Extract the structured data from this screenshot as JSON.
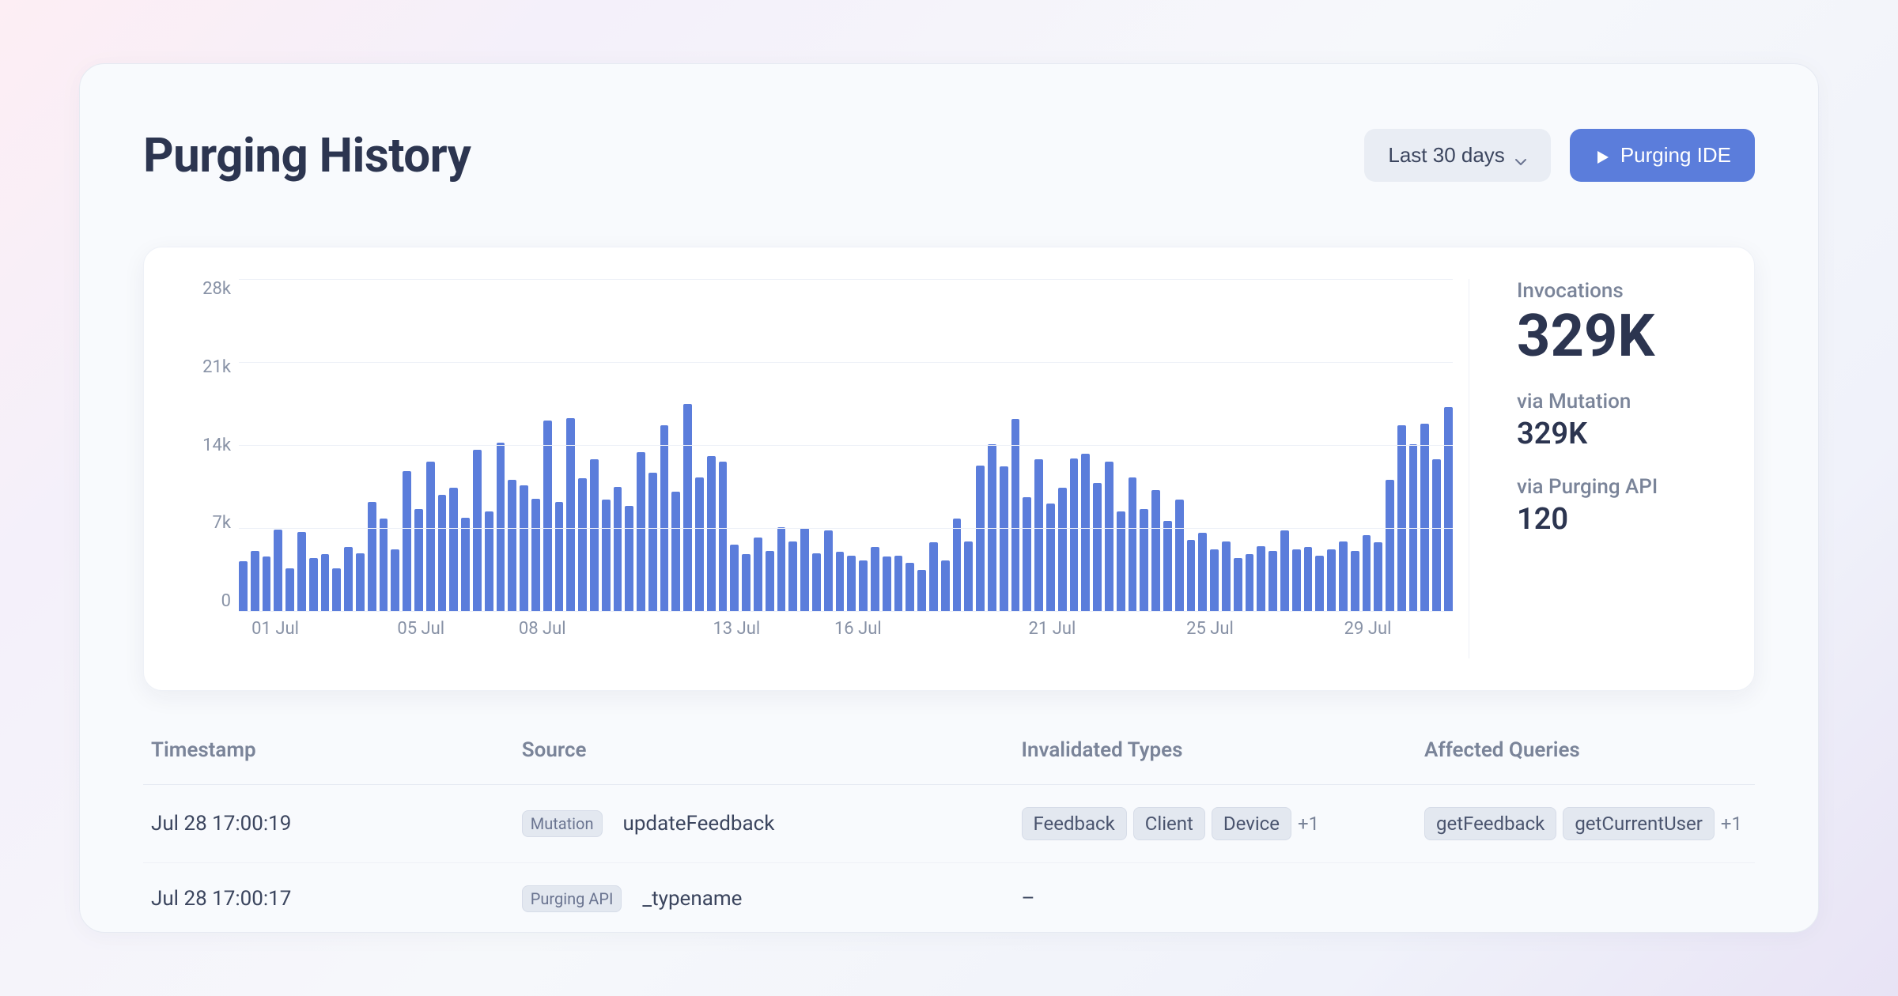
{
  "page": {
    "title": "Purging History"
  },
  "header": {
    "range_label": "Last 30 days",
    "cta_label": "Purging IDE"
  },
  "stats": {
    "invocations_label": "Invocations",
    "invocations_value": "329K",
    "mutation_label": "via Mutation",
    "mutation_value": "329K",
    "api_label": "via Purging API",
    "api_value": "120"
  },
  "chart_data": {
    "type": "bar",
    "ylim": [
      0,
      28000
    ],
    "y_ticks": [
      "28k",
      "21k",
      "14k",
      "7k",
      "0"
    ],
    "x_ticks": [
      {
        "label": "01 Jul",
        "pos": 3
      },
      {
        "label": "05 Jul",
        "pos": 15
      },
      {
        "label": "08 Jul",
        "pos": 25
      },
      {
        "label": "13 Jul",
        "pos": 41
      },
      {
        "label": "16 Jul",
        "pos": 51
      },
      {
        "label": "21 Jul",
        "pos": 67
      },
      {
        "label": "25 Jul",
        "pos": 80
      },
      {
        "label": "29 Jul",
        "pos": 93
      }
    ],
    "values": [
      4200,
      5100,
      4600,
      6900,
      3600,
      6700,
      4500,
      4800,
      3600,
      5400,
      4900,
      9200,
      7800,
      5200,
      11800,
      8600,
      12600,
      9800,
      10400,
      7900,
      13600,
      8400,
      14200,
      11100,
      10600,
      9500,
      16100,
      9200,
      16300,
      11200,
      12800,
      9400,
      10500,
      8900,
      13400,
      11700,
      15700,
      10100,
      17500,
      11300,
      13100,
      12600,
      5600,
      4800,
      6200,
      5100,
      7100,
      5900,
      7000,
      4900,
      6800,
      5000,
      4700,
      4300,
      5400,
      4600,
      4700,
      4100,
      3500,
      5800,
      4300,
      7800,
      5900,
      12300,
      14100,
      12200,
      16200,
      9600,
      12800,
      9100,
      10400,
      12900,
      13300,
      10800,
      12600,
      8400,
      11300,
      8600,
      10200,
      7600,
      9400,
      6000,
      6600,
      5200,
      5900,
      4500,
      4800,
      5500,
      5100,
      6800,
      5200,
      5400,
      4700,
      5200,
      5900,
      5100,
      6400,
      5800,
      11100,
      15700,
      14100,
      15800,
      12800,
      17200
    ]
  },
  "table": {
    "columns": [
      "Timestamp",
      "Source",
      "Invalidated Types",
      "Affected Queries"
    ],
    "rows": [
      {
        "timestamp": "Jul 28 17:00:19",
        "source_tag": "Mutation",
        "source_name": "updateFeedback",
        "types": [
          "Feedback",
          "Client",
          "Device"
        ],
        "types_more": "+1",
        "queries": [
          "getFeedback",
          "getCurrentUser"
        ],
        "queries_more": "+1"
      },
      {
        "timestamp": "Jul 28 17:00:17",
        "source_tag": "Purging API",
        "source_name": "_typename",
        "types": [],
        "types_placeholder": "–",
        "queries": [],
        "queries_placeholder": ""
      }
    ]
  }
}
